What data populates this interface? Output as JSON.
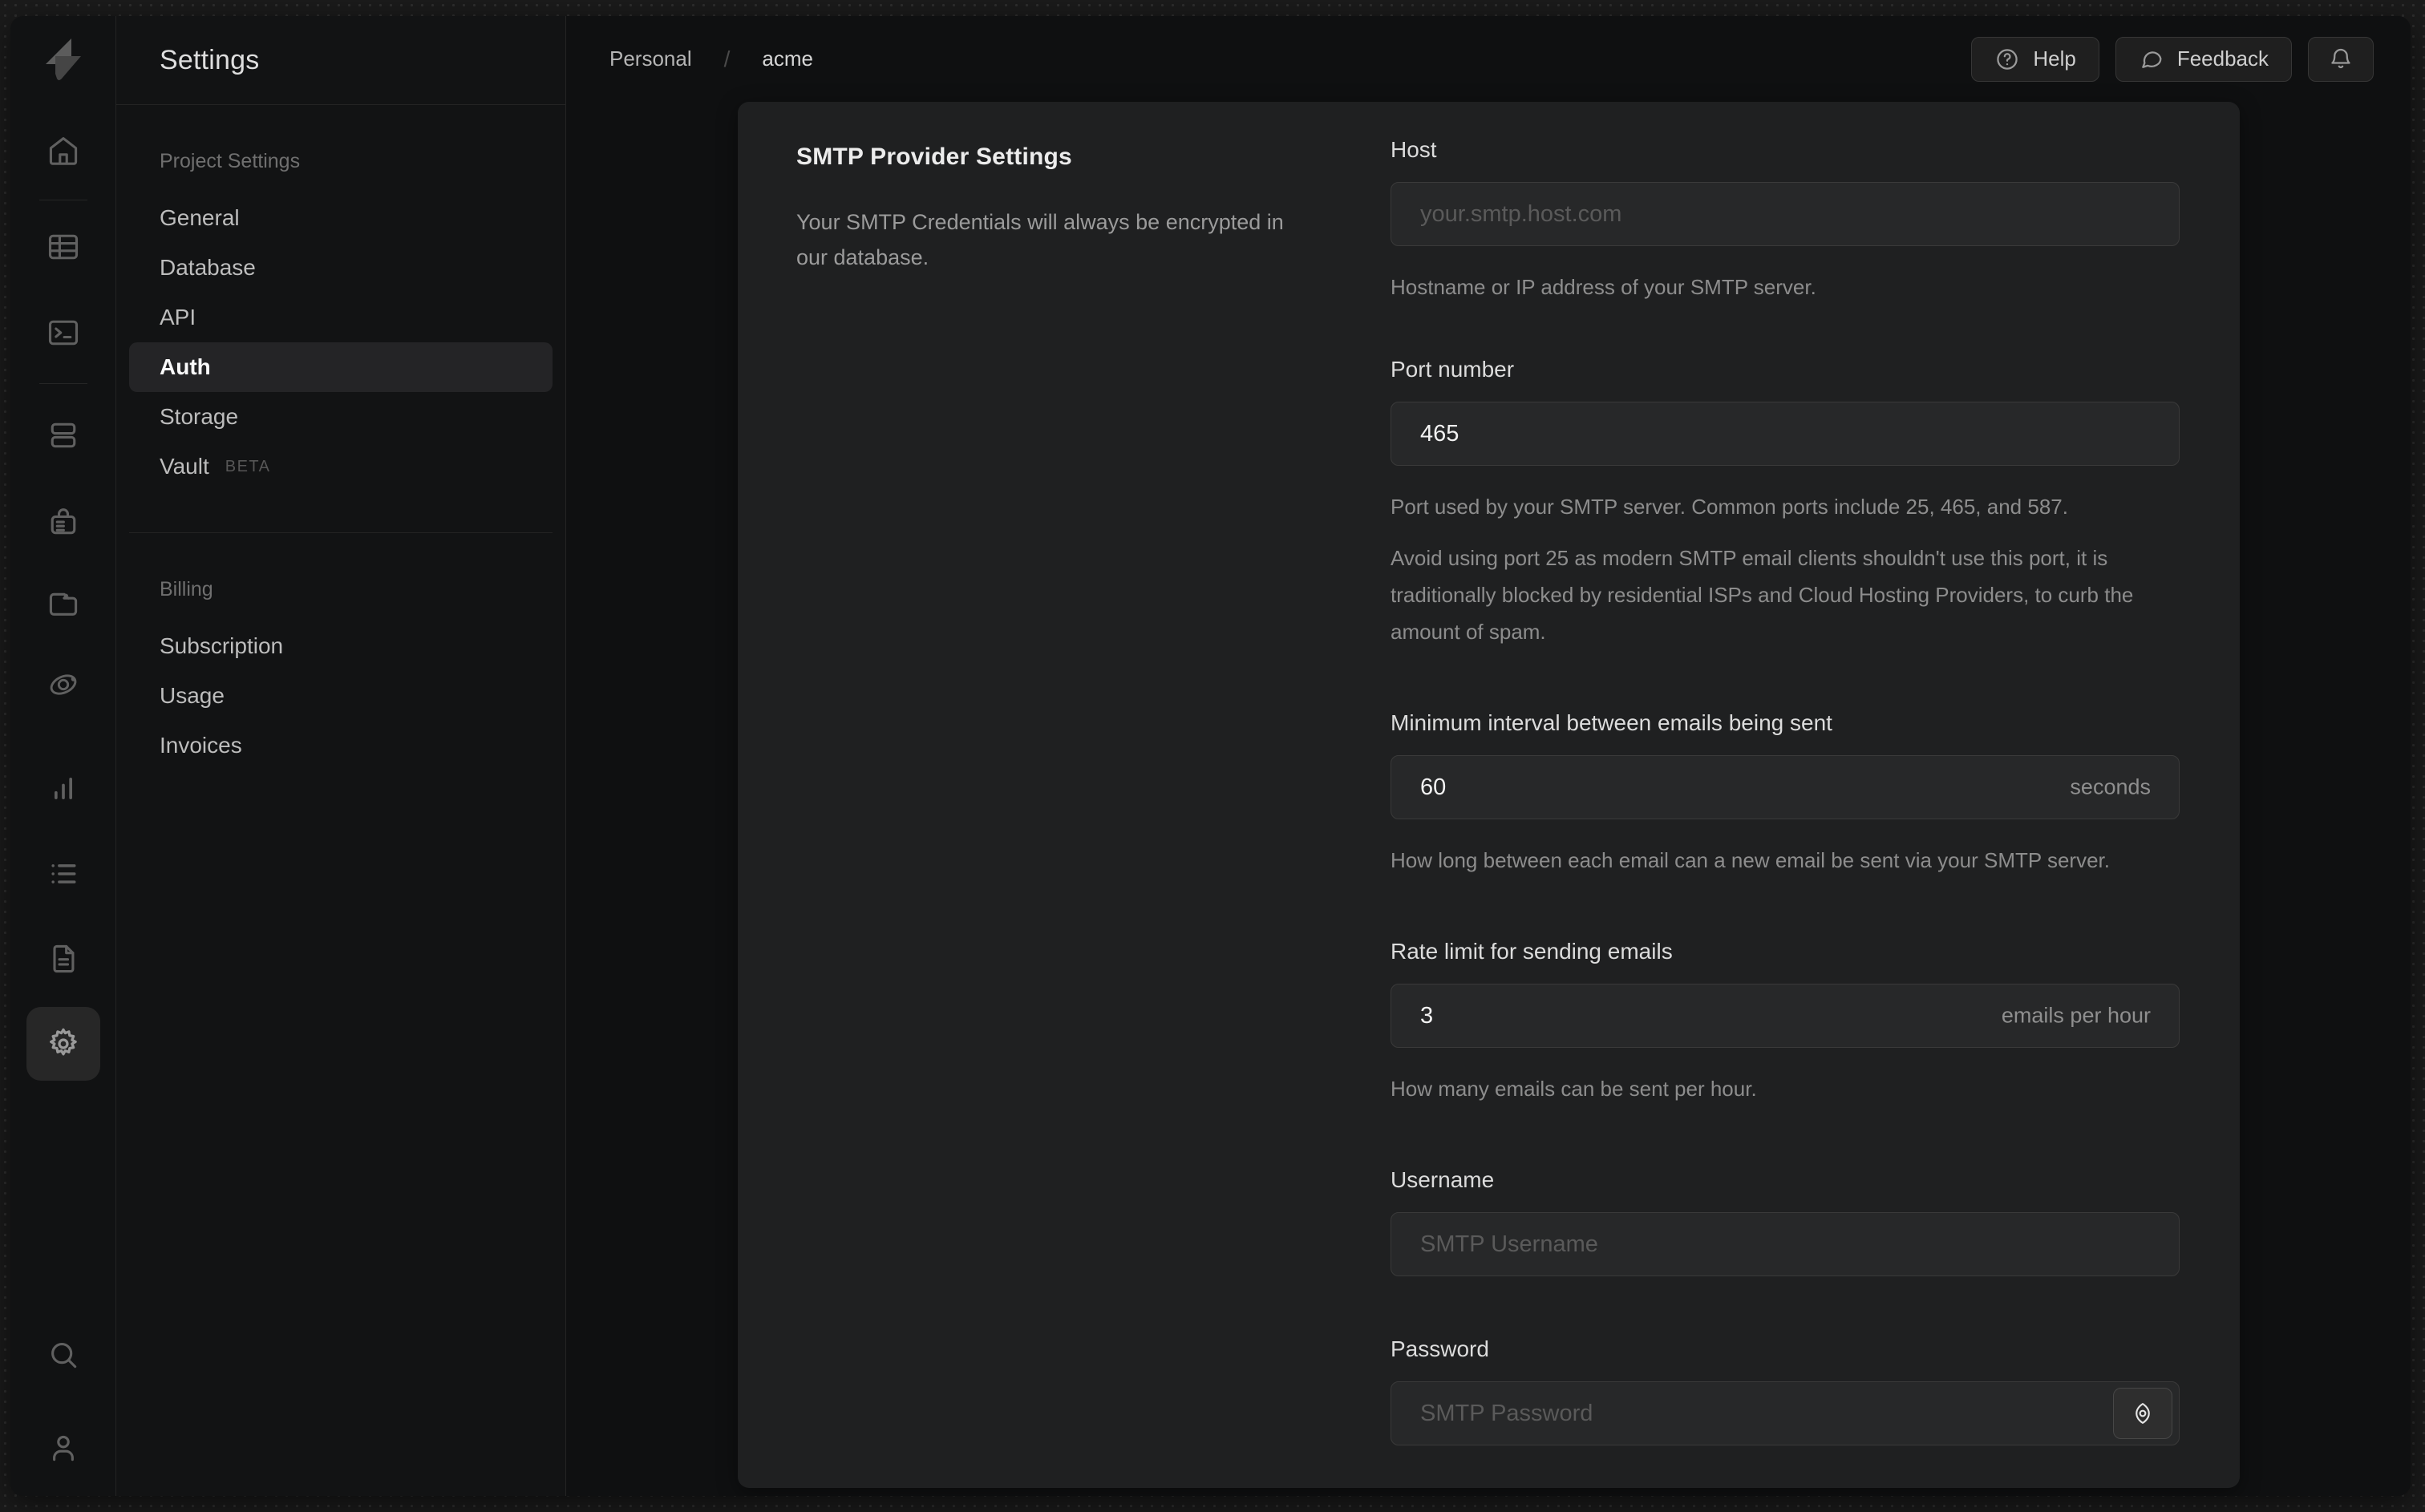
{
  "topbar": {
    "breadcrumb": {
      "org": "Personal",
      "separator": "/",
      "project": "acme"
    },
    "help_label": "Help",
    "feedback_label": "Feedback"
  },
  "rail": {
    "icons": [
      "home",
      "table-editor",
      "sql-editor",
      "database",
      "authentication",
      "storage",
      "edge-functions",
      "reports",
      "logs",
      "docs",
      "settings"
    ],
    "bottom_icons": [
      "search",
      "profile"
    ],
    "active": "settings"
  },
  "sidebar": {
    "title": "Settings",
    "sections": [
      {
        "header": "Project Settings",
        "items": [
          {
            "label": "General"
          },
          {
            "label": "Database"
          },
          {
            "label": "API"
          },
          {
            "label": "Auth",
            "active": true
          },
          {
            "label": "Storage"
          },
          {
            "label": "Vault",
            "badge": "BETA"
          }
        ]
      },
      {
        "header": "Billing",
        "items": [
          {
            "label": "Subscription"
          },
          {
            "label": "Usage"
          },
          {
            "label": "Invoices"
          }
        ]
      }
    ]
  },
  "panel": {
    "title": "SMTP Provider Settings",
    "description": "Your SMTP Credentials will always be encrypted in our database.",
    "fields": [
      {
        "label": "Host",
        "placeholder": "your.smtp.host.com",
        "helpers": [
          "Hostname or IP address of your SMTP server."
        ]
      },
      {
        "label": "Port number",
        "value": "465",
        "helpers": [
          "Port used by your SMTP server. Common ports include 25, 465, and 587.",
          "Avoid using port 25 as modern SMTP email clients shouldn't use this port, it is traditionally blocked by residential ISPs and Cloud Hosting Providers, to curb the amount of spam."
        ]
      },
      {
        "label": "Minimum interval between emails being sent",
        "value": "60",
        "suffix": "seconds",
        "helpers": [
          "How long between each email can a new email be sent via your SMTP server."
        ]
      },
      {
        "label": "Rate limit for sending emails",
        "value": "3",
        "suffix": "emails per hour",
        "helpers": [
          "How many emails can be sent per hour."
        ]
      },
      {
        "label": "Username",
        "placeholder": "SMTP Username"
      },
      {
        "label": "Password",
        "placeholder": "SMTP Password"
      }
    ]
  },
  "colors": {
    "desktop": "#1b1b1b",
    "window_bg": "#111213",
    "panel_bg": "#1f2021",
    "input_bg": "#272829",
    "active_item_bg": "#242426"
  }
}
